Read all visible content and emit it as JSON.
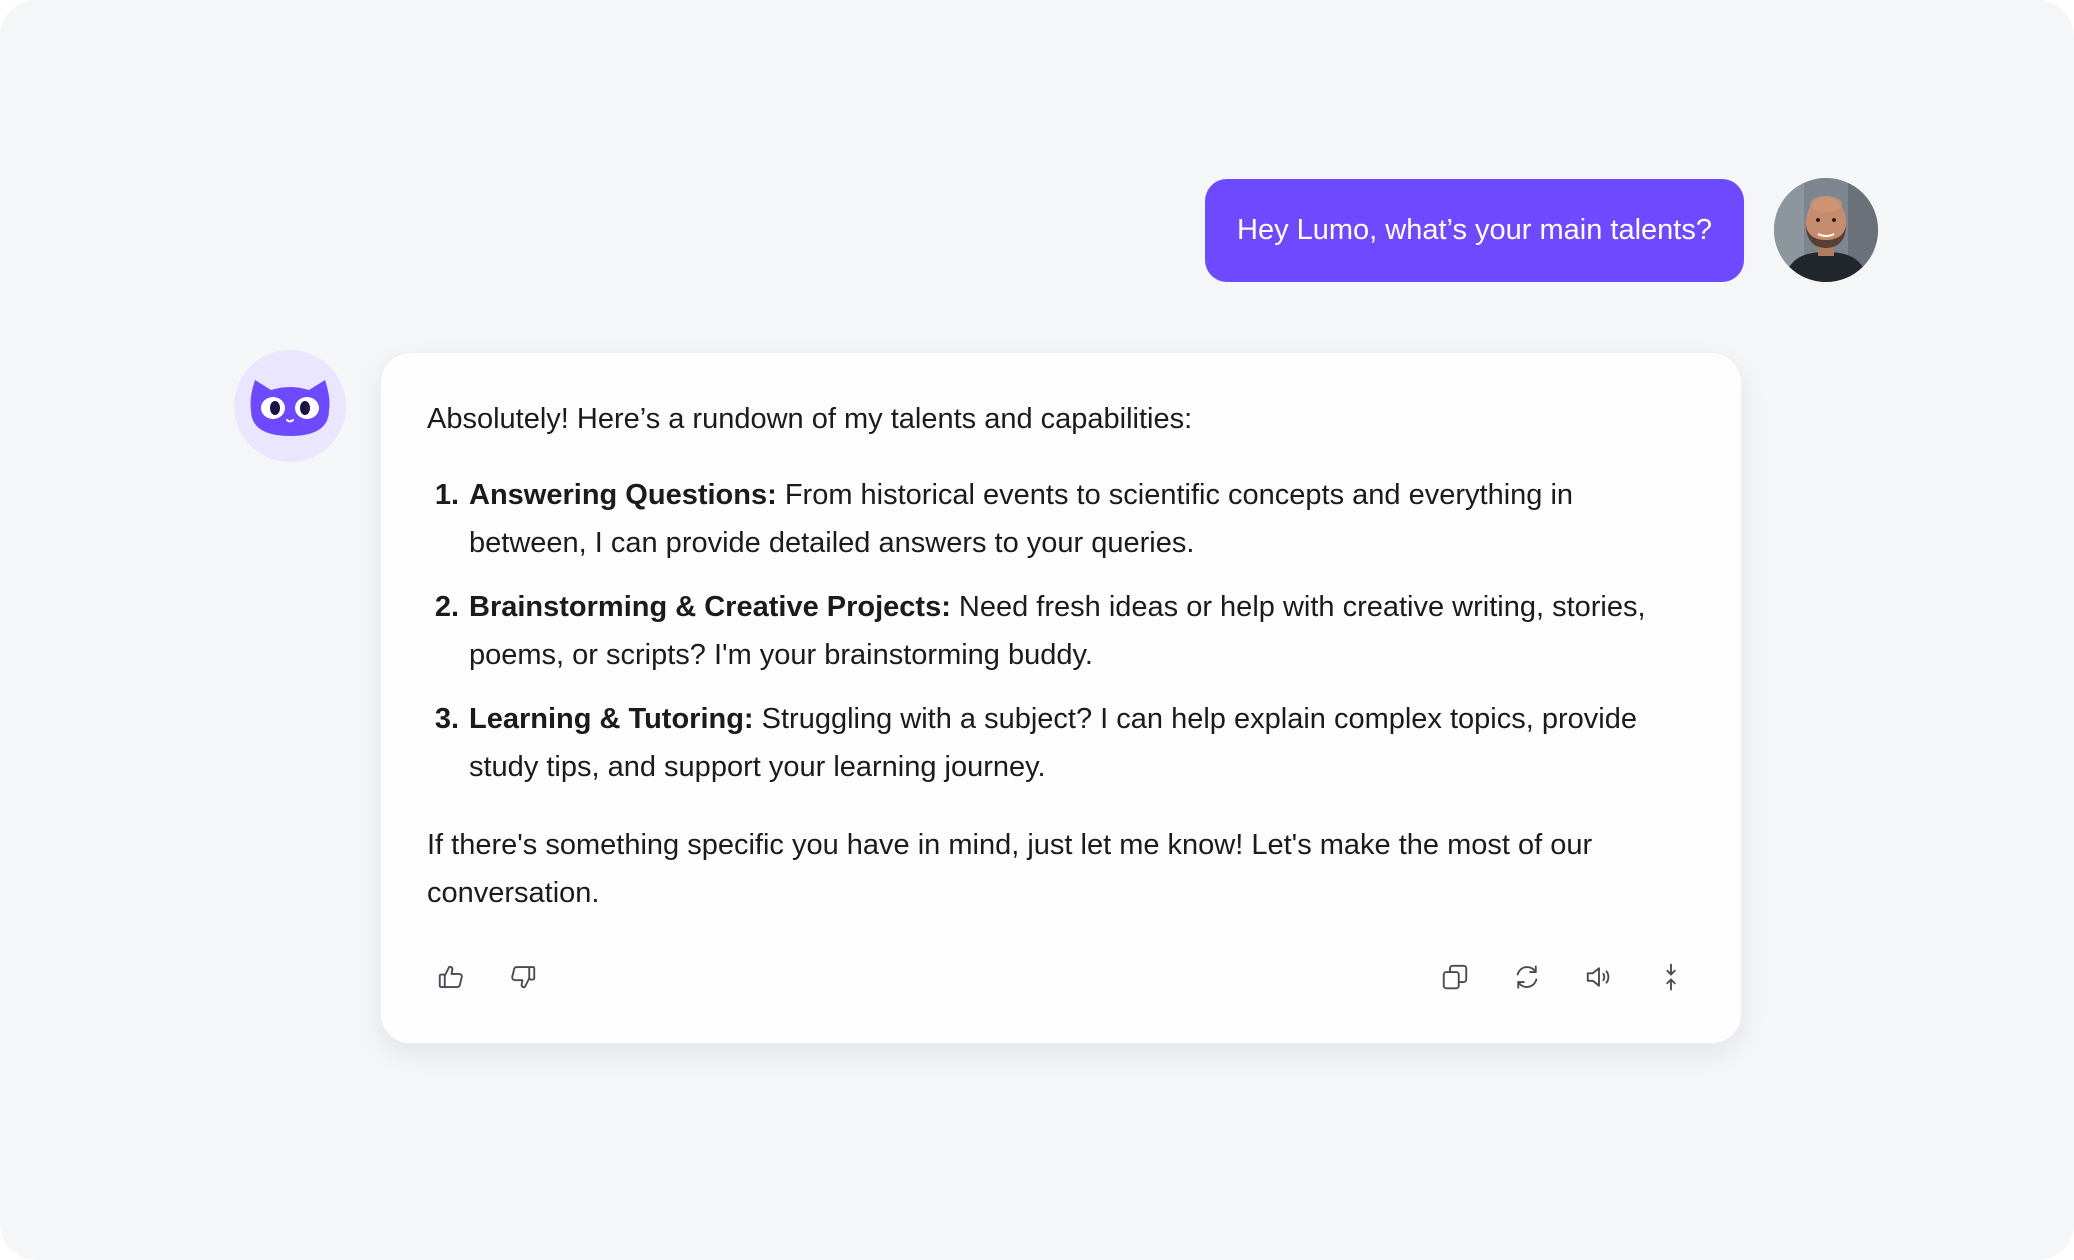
{
  "user_message": {
    "text": "Hey Lumo, what’s your main talents?",
    "bubble_color": "#6d4aff"
  },
  "assistant_message": {
    "avatar_icon": "lumo-cat-icon",
    "intro": "Absolutely! Here’s a rundown of my talents and capabilities:",
    "items": [
      {
        "number": "1.",
        "lead": "Answering Questions:",
        "text": " From historical events to scientific concepts and everything in between, I can provide detailed answers to your queries."
      },
      {
        "number": "2.",
        "lead": "Brainstorming & Creative Projects:",
        "text": " Need fresh ideas or help with creative writing, stories, poems, or scripts? I'm your brainstorming buddy."
      },
      {
        "number": "3.",
        "lead": "Learning & Tutoring:",
        "text": " Struggling with a subject? I can help explain complex topics, provide study tips, and support your learning journey."
      }
    ],
    "outro": "If there's something specific you have in mind, just let me know! Let's make the most of our conversation."
  },
  "actions": {
    "left": [
      "thumbs-up-icon",
      "thumbs-down-icon"
    ],
    "right": [
      "copy-icon",
      "regenerate-icon",
      "speaker-icon",
      "collapse-icon"
    ]
  },
  "colors": {
    "accent": "#6d4aff",
    "background": "#f5f6f8",
    "card": "#fdfdfd",
    "text": "#1b1b1f",
    "icon": "#4a4a55"
  }
}
